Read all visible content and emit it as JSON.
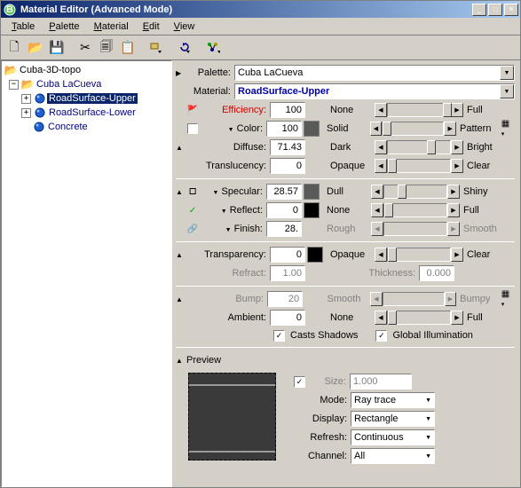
{
  "title": "Material Editor (Advanced Mode)",
  "menu": {
    "table": "Table",
    "palette": "Palette",
    "material": "Material",
    "edit": "Edit",
    "view": "View"
  },
  "tree": {
    "root": "Cuba-3D-topo",
    "palette": "Cuba LaCueva",
    "items": [
      "RoadSurface-Upper",
      "RoadSurface-Lower",
      "Concrete"
    ]
  },
  "header": {
    "palette_label": "Palette:",
    "material_label": "Material:",
    "palette_value": "Cuba LaCueva",
    "material_value": "RoadSurface-Upper"
  },
  "props": {
    "efficiency": {
      "label": "Efficiency:",
      "value": "100",
      "left": "None",
      "right": "Full",
      "thumb": 62
    },
    "color": {
      "label": "Color:",
      "value": "100",
      "swatch": "#5a5a5a",
      "left": "Solid",
      "right": "Pattern",
      "thumb": 0
    },
    "diffuse": {
      "label": "Diffuse:",
      "value": "71.43",
      "left": "Dark",
      "right": "Bright",
      "thumb": 44
    },
    "translucency": {
      "label": "Translucency:",
      "value": "0",
      "left": "Opaque",
      "right": "Clear",
      "thumb": 0
    },
    "specular": {
      "label": "Specular:",
      "value": "28.57",
      "swatch": "#5a5a5a",
      "left": "Dull",
      "right": "Shiny",
      "thumb": 15
    },
    "reflect": {
      "label": "Reflect:",
      "value": "0",
      "swatch": "#000000",
      "left": "None",
      "right": "Full",
      "thumb": 0
    },
    "finish": {
      "label": "Finish:",
      "value": "28.",
      "left": "Rough",
      "right": "Smooth"
    },
    "transparency": {
      "label": "Transparency:",
      "value": "0",
      "swatch": "#000000",
      "left": "Opaque",
      "right": "Clear",
      "thumb": 0
    },
    "refract": {
      "label": "Refract:",
      "value": "1.00"
    },
    "thickness": {
      "label": "Thickness:",
      "value": "0.000"
    },
    "bump": {
      "label": "Bump:",
      "value": "20",
      "left": "Smooth",
      "right": "Bumpy"
    },
    "ambient": {
      "label": "Ambient:",
      "value": "0",
      "left": "None",
      "right": "Full",
      "thumb": 0
    },
    "casts_shadows": "Casts Shadows",
    "global_illum": "Global Illumination"
  },
  "preview": {
    "label": "Preview",
    "size_label": "Size:",
    "size_value": "1.000",
    "mode_label": "Mode:",
    "mode_value": "Ray trace",
    "display_label": "Display:",
    "display_value": "Rectangle",
    "refresh_label": "Refresh:",
    "refresh_value": "Continuous",
    "channel_label": "Channel:",
    "channel_value": "All"
  }
}
